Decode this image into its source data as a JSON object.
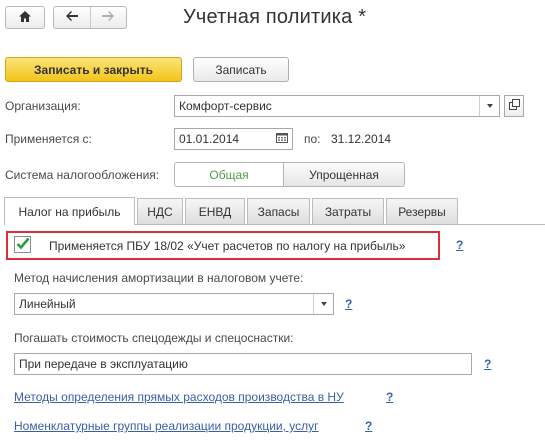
{
  "window": {
    "title": "Учетная политика *"
  },
  "nav": {
    "home_icon": "home-icon",
    "back_icon": "arrow-left-icon",
    "forward_icon": "arrow-right-icon"
  },
  "toolbar": {
    "save_close_label": "Записать и закрыть",
    "save_label": "Записать"
  },
  "organization": {
    "label": "Организация:",
    "value": "Комфорт-сервис"
  },
  "applies": {
    "label": "Применяется с:",
    "from": "01.01.2014",
    "to_label": "по:",
    "to": "31.12.2014"
  },
  "tax_system": {
    "label": "Система налогообложения:",
    "options": [
      "Общая",
      "Упрощенная"
    ],
    "selected": "Общая"
  },
  "tabs": [
    {
      "label": "Налог на прибыль",
      "active": true
    },
    {
      "label": "НДС"
    },
    {
      "label": "ЕНВД"
    },
    {
      "label": "Запасы"
    },
    {
      "label": "Затраты"
    },
    {
      "label": "Резервы"
    }
  ],
  "pbu": {
    "label": "Применяется ПБУ 18/02 «Учет расчетов по налогу на прибыль»",
    "checked": true,
    "help": "?"
  },
  "depreciation": {
    "label": "Метод начисления амортизации в налоговом учете:",
    "value": "Линейный",
    "help": "?"
  },
  "workwear": {
    "label": "Погашать стоимость спецодежды и спецоснастки:",
    "value": "При передаче в эксплуатацию",
    "help": "?"
  },
  "links": [
    {
      "label": "Методы определения прямых расходов производства в НУ",
      "help": "?"
    },
    {
      "label": "Номенклатурные группы реализации продукции, услуг",
      "help": "?"
    }
  ],
  "colors": {
    "accent_yellow": "#f2c419",
    "highlight_red": "#d8313b",
    "link_blue": "#3a5fa8",
    "selected_green": "#4e9c4a"
  }
}
